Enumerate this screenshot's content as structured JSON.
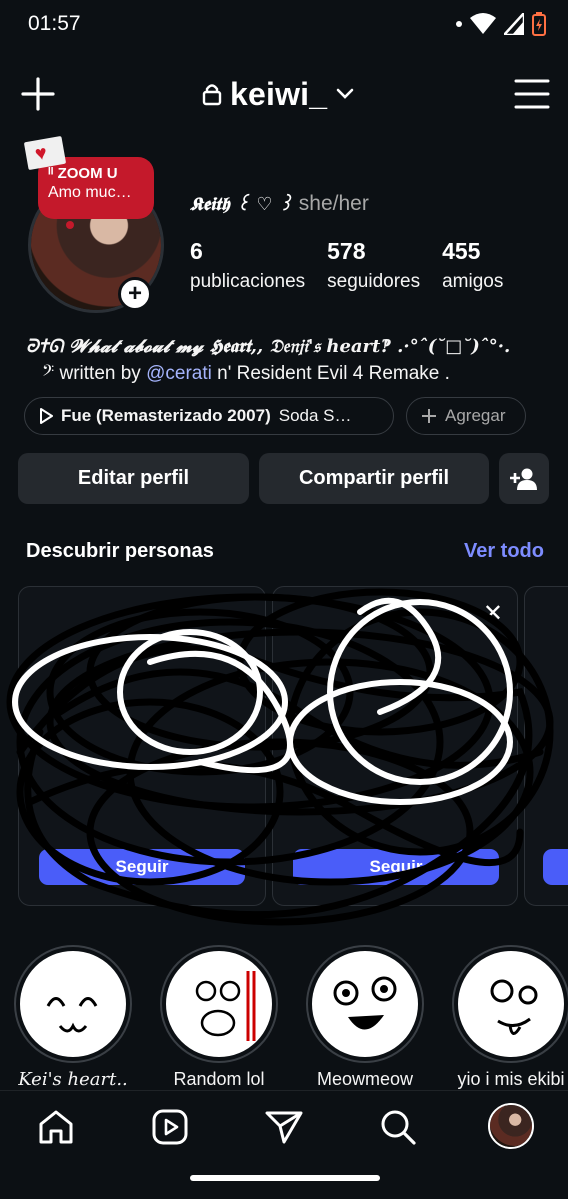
{
  "status": {
    "time": "01:57"
  },
  "header": {
    "username": "keiwi_"
  },
  "profile": {
    "note_line1": "ᴵᴵ ZOOM U",
    "note_line2": "Amo muc…",
    "display_name": "𝕶𝖊𝖎𝖙𝖍 ꒰ ♡ ꒱",
    "pronouns": "she/her",
    "stats": [
      {
        "value": "6",
        "label": "publicaciones"
      },
      {
        "value": "578",
        "label": "seguidores"
      },
      {
        "value": "455",
        "label": "amigos"
      }
    ],
    "bio_line1": "ᘒ✝ᘏ 𝓦𝓱𝓪𝓽 𝓪𝓫𝓸𝓾𝓽 𝓶𝔂 𝕳𝖊𝖆𝖗𝖙,, 𝔇𝔢𝔫𝔧𝔦'𝔰 heart‽ .·°ˆ(˘□˘)ˆ°·.",
    "bio_line2_prefix": "𝄢 written by ",
    "bio_mention": "@cerati",
    "bio_line2_suffix": " n' Resident Evil 4 Remake ."
  },
  "chips": {
    "song_title": "Fue (Remasterizado 2007)",
    "song_artist": "Soda S…",
    "add_label": "Agregar"
  },
  "actions": {
    "edit": "Editar perfil",
    "share": "Compartir perfil"
  },
  "discover": {
    "title": "Descubrir personas",
    "see_all": "Ver todo",
    "follow_1": "Seguir",
    "follow_2": "Seguir"
  },
  "highlights": [
    {
      "label": "Kei's heart.."
    },
    {
      "label": "Random lol"
    },
    {
      "label": "Meowmeow"
    },
    {
      "label": "yio i mis ekibi"
    }
  ],
  "colors": {
    "background": "#0c1014",
    "accent": "#4a5df9",
    "link": "#7d8cff",
    "note": "#c4192b"
  }
}
